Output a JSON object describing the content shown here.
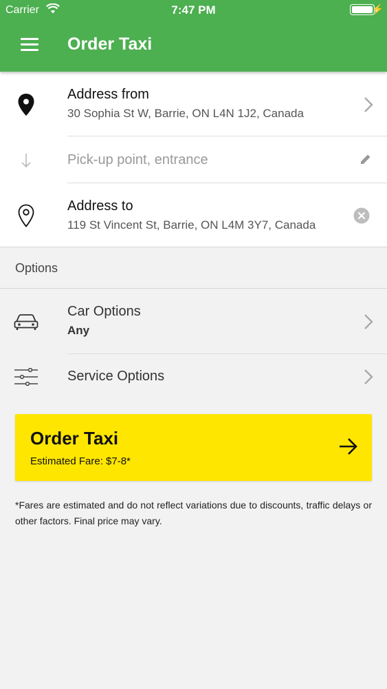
{
  "status_bar": {
    "carrier": "Carrier",
    "time": "7:47 PM"
  },
  "nav": {
    "title": "Order Taxi",
    "menu_icon": "menu-icon"
  },
  "address_from": {
    "title": "Address from",
    "value": "30 Sophia St W, Barrie, ON L4N 1J2, Canada",
    "icon": "pin-filled-icon"
  },
  "pickup": {
    "placeholder": "Pick-up point, entrance",
    "icon": "arrow-down-icon"
  },
  "address_to": {
    "title": "Address to",
    "value": "119 St Vincent St, Barrie, ON L4M 3Y7, Canada",
    "icon": "pin-outline-icon"
  },
  "options": {
    "header": "Options",
    "car": {
      "title": "Car Options",
      "value": "Any",
      "icon": "car-icon"
    },
    "service": {
      "title": "Service Options",
      "icon": "sliders-icon"
    }
  },
  "order_button": {
    "label": "Order Taxi",
    "fare": "Estimated Fare: $7-8*"
  },
  "disclaimer": "*Fares are estimated and do not reflect variations due to discounts, traffic delays or other factors. Final price may vary.",
  "colors": {
    "header_green": "#4caf50",
    "button_yellow": "#ffe600"
  }
}
